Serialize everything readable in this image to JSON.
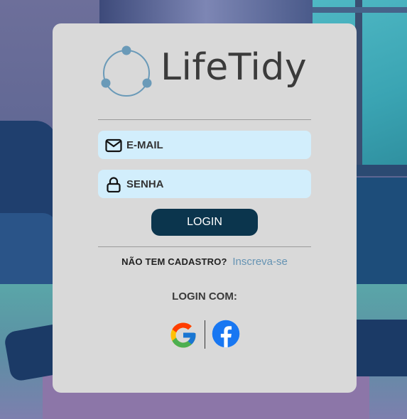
{
  "brand": {
    "name": "LifeTidy",
    "logo_icon": "three-dot-cycle-icon",
    "logo_color": "#6a9ab8"
  },
  "form": {
    "email_placeholder": "E-MAIL",
    "password_placeholder": "SENHA",
    "login_label": "LOGIN",
    "field_background": "#d2eefc",
    "button_color": "#0b354d"
  },
  "signup": {
    "question": "NÃO TEM CADASTRO?",
    "link_label": "Inscreva-se",
    "link_color": "#6593b3"
  },
  "social": {
    "label": "LOGIN COM:",
    "providers": [
      "google-icon",
      "facebook-icon"
    ]
  }
}
